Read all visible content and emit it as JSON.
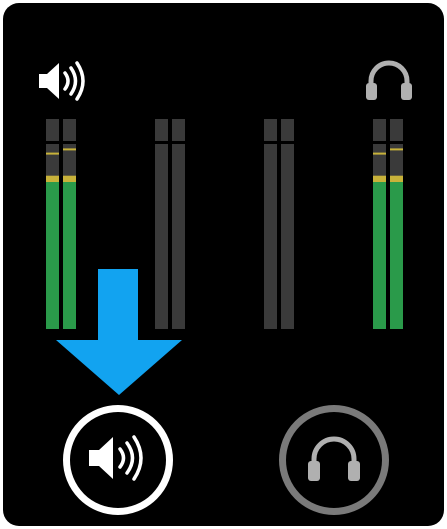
{
  "colors": {
    "background": "#000000",
    "meter_track": "#3a3a3a",
    "meter_green": "#2a9a4a",
    "meter_yellow": "#c8b23a",
    "arrow": "#12a3f0",
    "active_ring": "#ffffff",
    "inactive_ring": "#7a7a7a",
    "speaker_icon": "#ffffff",
    "headphones_icon": "#b0b0b0"
  },
  "header": {
    "left_icon": "speaker-icon",
    "right_icon": "headphones-icon"
  },
  "meters": [
    {
      "name": "speaker-meter-left",
      "level": 0.73,
      "peak": 0.84
    },
    {
      "name": "speaker-meter-right",
      "level": 0.73,
      "peak": 0.86
    },
    {
      "name": "channel-2-meter-left",
      "level": 0.0,
      "peak": 0.0
    },
    {
      "name": "channel-2-meter-right",
      "level": 0.0,
      "peak": 0.0
    },
    {
      "name": "channel-3-meter-left",
      "level": 0.0,
      "peak": 0.0
    },
    {
      "name": "channel-3-meter-right",
      "level": 0.0,
      "peak": 0.0
    },
    {
      "name": "headphones-meter-left",
      "level": 0.73,
      "peak": 0.84
    },
    {
      "name": "headphones-meter-right",
      "level": 0.73,
      "peak": 0.86
    }
  ],
  "indicator": {
    "icon": "down-arrow-icon",
    "target": "speaker-output-button"
  },
  "buttons": [
    {
      "name": "speaker-output-button",
      "icon": "speaker-icon",
      "active": true
    },
    {
      "name": "headphones-output-button",
      "icon": "headphones-icon",
      "active": false
    }
  ]
}
